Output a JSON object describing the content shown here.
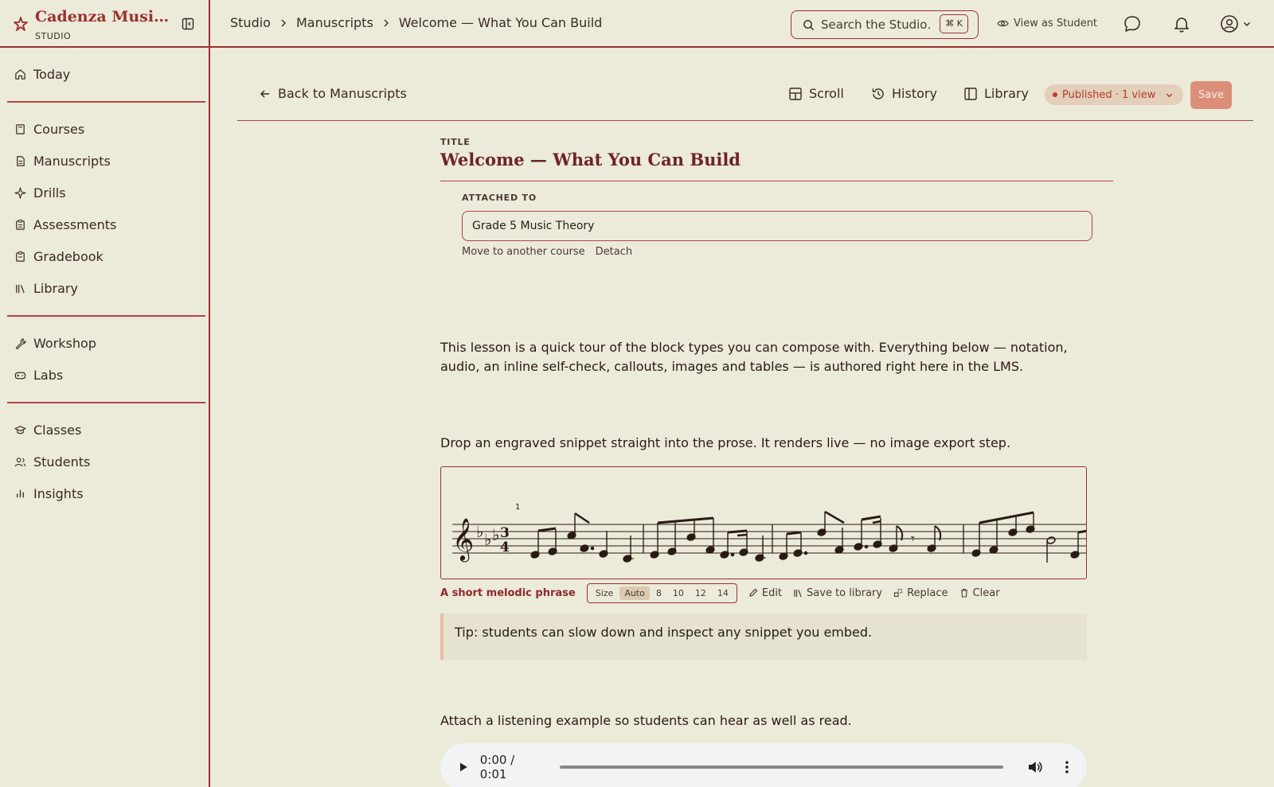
{
  "brand": {
    "name": "Cadenza Music Studio",
    "subtitle": "STUDIO"
  },
  "sidebar": {
    "groups": [
      [
        {
          "label": "Today",
          "icon": "home-icon"
        }
      ],
      [
        {
          "label": "Courses",
          "icon": "book-icon"
        },
        {
          "label": "Manuscripts",
          "icon": "document-icon"
        },
        {
          "label": "Drills",
          "icon": "sparkle-icon"
        },
        {
          "label": "Assessments",
          "icon": "clipboard-icon"
        },
        {
          "label": "Gradebook",
          "icon": "clipboard-check-icon"
        },
        {
          "label": "Library",
          "icon": "library-icon"
        }
      ],
      [
        {
          "label": "Workshop",
          "icon": "wrench-icon"
        },
        {
          "label": "Labs",
          "icon": "gamepad-icon"
        }
      ],
      [
        {
          "label": "Classes",
          "icon": "graduation-cap-icon"
        },
        {
          "label": "Students",
          "icon": "users-icon"
        },
        {
          "label": "Insights",
          "icon": "bar-chart-icon"
        }
      ]
    ]
  },
  "breadcrumb": [
    "Studio",
    "Manuscripts",
    "Welcome — What You Can Build"
  ],
  "search": {
    "placeholder": "Search the Studio…",
    "shortcut": "⌘ K"
  },
  "header": {
    "view_as_student": "View as Student"
  },
  "toolbar": {
    "back": "Back to Manuscripts",
    "scroll": "Scroll",
    "history": "History",
    "library": "Library",
    "status": "Published · 1 view",
    "save": "Save"
  },
  "doc": {
    "title_label": "TITLE",
    "title": "Welcome — What You Can Build",
    "attached_label": "ATTACHED TO",
    "attached_value": "Grade 5 Music Theory",
    "move_link": "Move to another course",
    "detach_link": "Detach",
    "intro": "This lesson is a quick tour of the block types you can compose with. Everything below — notation, audio, an inline self-check, callouts, images and tables — is authored right here in the LMS.",
    "notation_intro": "Drop an engraved snippet straight into the prose. It renders live — no image export step.",
    "measure_number": "1",
    "notation_caption": "A short melodic phrase",
    "size_label": "Size",
    "size_options": [
      "Auto",
      "8",
      "10",
      "12",
      "14"
    ],
    "size_selected": "Auto",
    "edit": "Edit",
    "save_to_library": "Save to library",
    "replace": "Replace",
    "clear": "Clear",
    "tip": "Tip: students can slow down and inspect any snippet you embed.",
    "audio_intro": "Attach a listening example so students can hear as well as read.",
    "audio_time": "0:00 / 0:01"
  }
}
